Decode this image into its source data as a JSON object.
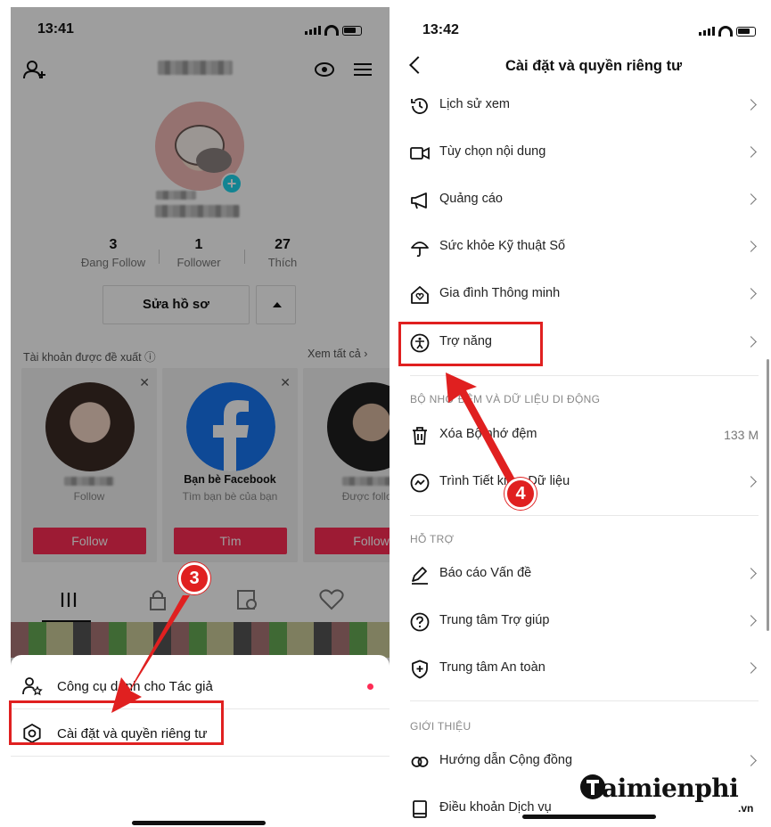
{
  "left_screen": {
    "time": "13:41",
    "stats": [
      {
        "num": "3",
        "label": "Đang Follow"
      },
      {
        "num": "1",
        "label": "Follower"
      },
      {
        "num": "27",
        "label": "Thích"
      }
    ],
    "edit_profile": "Sửa hồ sơ",
    "suggested_title": "Tài khoản được đề xuất ⓘ",
    "see_all": "Xem tất cả ›",
    "cards": [
      {
        "name": "",
        "sub": "Follow",
        "button": "Follow"
      },
      {
        "name": "Bạn bè Facebook",
        "sub": "Tìm bạn bè của bạn",
        "button": "Tìm"
      },
      {
        "name": "",
        "sub": "Được follow",
        "button": "Follow"
      }
    ],
    "sheet": {
      "creator_tools": "Công cụ dành cho Tác giả",
      "settings": "Cài đặt và quyền riêng tư"
    }
  },
  "right_screen": {
    "time": "13:42",
    "title": "Cài đặt và quyền riêng tư",
    "rows_top": [
      {
        "label": "Lịch sử xem",
        "icon": "history-icon"
      },
      {
        "label": "Tùy chọn nội dung",
        "icon": "video-icon"
      },
      {
        "label": "Quảng cáo",
        "icon": "megaphone-icon"
      },
      {
        "label": "Sức khỏe Kỹ thuật Số",
        "icon": "umbrella-icon"
      },
      {
        "label": "Gia đình Thông minh",
        "icon": "home-heart-icon"
      },
      {
        "label": "Trợ năng",
        "icon": "accessibility-icon"
      }
    ],
    "section_cache": "BỘ NHỚ ĐỆM VÀ DỮ LIỆU DI ĐỘNG",
    "clear_cache": "Xóa Bộ nhớ đệm",
    "clear_cache_value": "133 M",
    "data_saver": "Trình Tiết kiệm Dữ liệu",
    "section_support": "HỖ TRỢ",
    "report": "Báo cáo Vấn đề",
    "help_center": "Trung tâm Trợ giúp",
    "safety_center": "Trung tâm An toàn",
    "section_about": "GIỚI THIỆU",
    "community": "Hướng dẫn Cộng đồng",
    "terms": "Điều khoản Dịch vụ"
  },
  "annotations": {
    "step3": "3",
    "step4": "4",
    "highlight_color": "#e02020"
  },
  "watermark": {
    "brand": "aimienphi",
    "domain": ".vn"
  }
}
